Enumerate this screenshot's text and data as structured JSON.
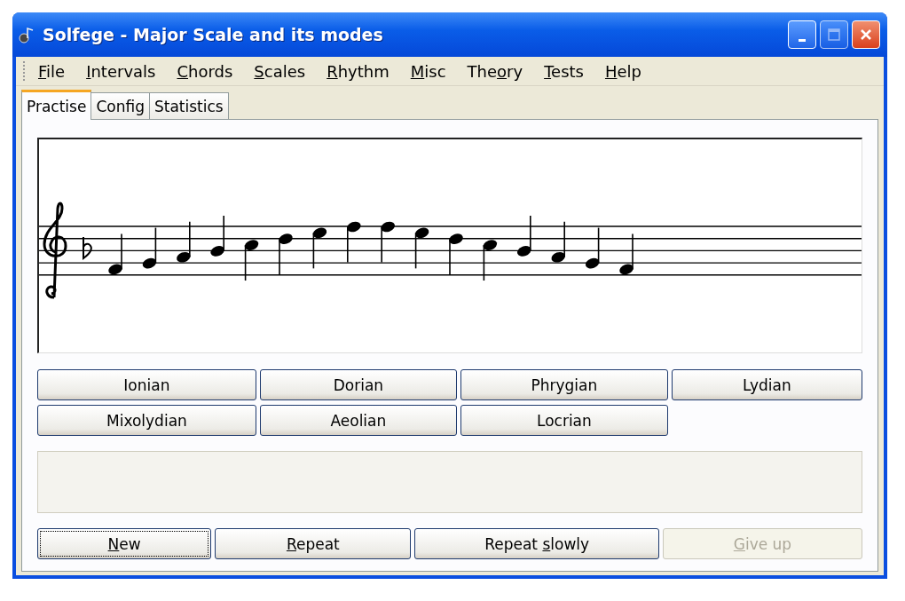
{
  "window": {
    "title": "Solfege - Major Scale and its modes"
  },
  "menu": [
    {
      "key": "F",
      "post": "ile"
    },
    {
      "key": "I",
      "post": "ntervals"
    },
    {
      "key": "C",
      "post": "hords"
    },
    {
      "key": "S",
      "post": "cales"
    },
    {
      "key": "R",
      "post": "hythm"
    },
    {
      "key": "M",
      "post": "isc"
    },
    {
      "pre": "The",
      "key": "o",
      "post": "ry"
    },
    {
      "key": "T",
      "post": "ests"
    },
    {
      "key": "H",
      "post": "elp"
    }
  ],
  "tabs": [
    {
      "label": "Practise",
      "selected": true
    },
    {
      "label": "Config",
      "selected": false
    },
    {
      "label": "Statistics",
      "selected": false
    }
  ],
  "answers": [
    "Ionian",
    "Dorian",
    "Phrygian",
    "Lydian",
    "Mixolydian",
    "Aeolian",
    "Locrian"
  ],
  "actions": [
    {
      "key": "N",
      "post": "ew",
      "disabled": false,
      "focused": true
    },
    {
      "key": "R",
      "post": "epeat",
      "disabled": false,
      "focused": false
    },
    {
      "pre": "Repeat ",
      "key": "s",
      "post": "lowly",
      "disabled": false,
      "focused": false
    },
    {
      "key": "G",
      "post": "ive up",
      "disabled": true,
      "focused": false
    }
  ]
}
